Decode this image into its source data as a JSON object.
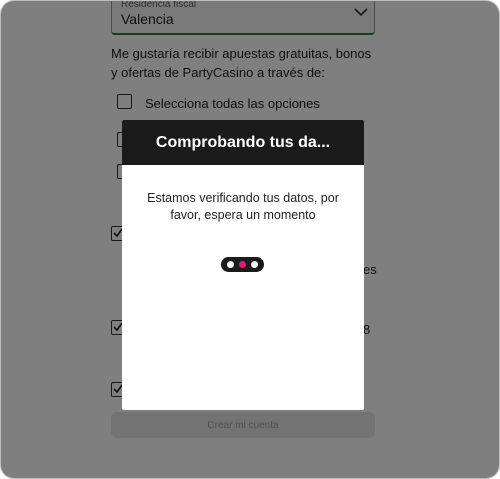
{
  "form": {
    "residence": {
      "label": "Residencia fiscal",
      "value": "Valencia"
    },
    "marketing_intro": "Me gustaría recibir apuestas gratuitas, bonos y ofertas de PartyCasino a través de:",
    "select_all_label": "Selecciona todas las opciones",
    "partial_text_1": "es",
    "partial_text_2": "8",
    "create_account_label": "Crear mi cuenta"
  },
  "modal": {
    "title": "Comprobando tus da...",
    "message": "Estamos verificando tus datos, por favor, espera un momento"
  },
  "colors": {
    "overlay": "rgba(0,0,0,0.5)",
    "modal_header": "#1b1b1b",
    "loader_active_dot": "#e0197d",
    "field_underline": "#2e7d32"
  }
}
